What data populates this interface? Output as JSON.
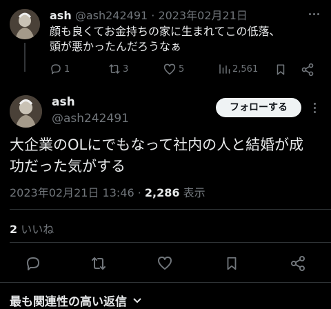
{
  "reply_tweet": {
    "display_name": "ash",
    "handle": "@ash242491",
    "date": "· 2023年02月21日",
    "text_line1": "顔も良くてお金持ちの家に生まれてこの低落、",
    "text_line2": "頭が悪かったんだろうなぁ",
    "replies": "1",
    "retweets": "3",
    "likes": "5",
    "views": "2,561"
  },
  "main_tweet": {
    "display_name": "ash",
    "handle": "@ash242491",
    "follow_label": "フォローする",
    "text_line1": "大企業のOLにでもなって社内の人と結婚が成",
    "text_line2": "功だった気がする",
    "timestamp": "2023年02月21日 13:46 · ",
    "view_count": "2,286",
    "view_label": " 表示",
    "likes_count": "2",
    "likes_label": " いいね"
  },
  "footer": {
    "sort_label": "最も関連性の高い返信"
  },
  "colors": {
    "background": "#000000",
    "text": "#e7e9ea",
    "muted": "#71767b",
    "divider": "#2f3336",
    "button_bg": "#eff3f4"
  },
  "icons": [
    "reply-icon",
    "retweet-icon",
    "heart-icon",
    "views-icon",
    "bookmark-icon",
    "share-icon",
    "more-icon",
    "chevron-down-icon"
  ]
}
